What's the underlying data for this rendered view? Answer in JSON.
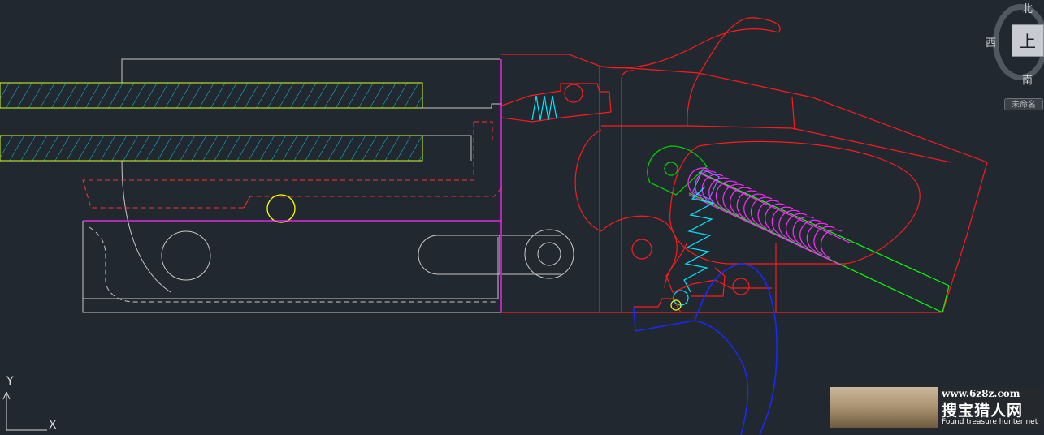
{
  "viewcube": {
    "north": "北",
    "west": "西",
    "south": "南",
    "top_face": "上",
    "wcs_label": "未命名"
  },
  "ucs": {
    "x_label": "X",
    "y_label": "Y"
  },
  "watermark": {
    "url": "www.6z8z.com",
    "site_name": "搜宝猎人网",
    "tagline": "Found treasure hunter net"
  },
  "colors": {
    "background": "#212830",
    "receiver": "#ff0000",
    "barrel": "#d4ff2a",
    "hatch": "#00e5ff",
    "hidden": "#c8c8c8",
    "mainspring": "#ff2aff",
    "sear_spring": "#00e5ff",
    "hammer_pivot": "#00d000",
    "trigger": "#0026ff",
    "pin": "#ffff00",
    "guide_rod": "#00ff00"
  }
}
